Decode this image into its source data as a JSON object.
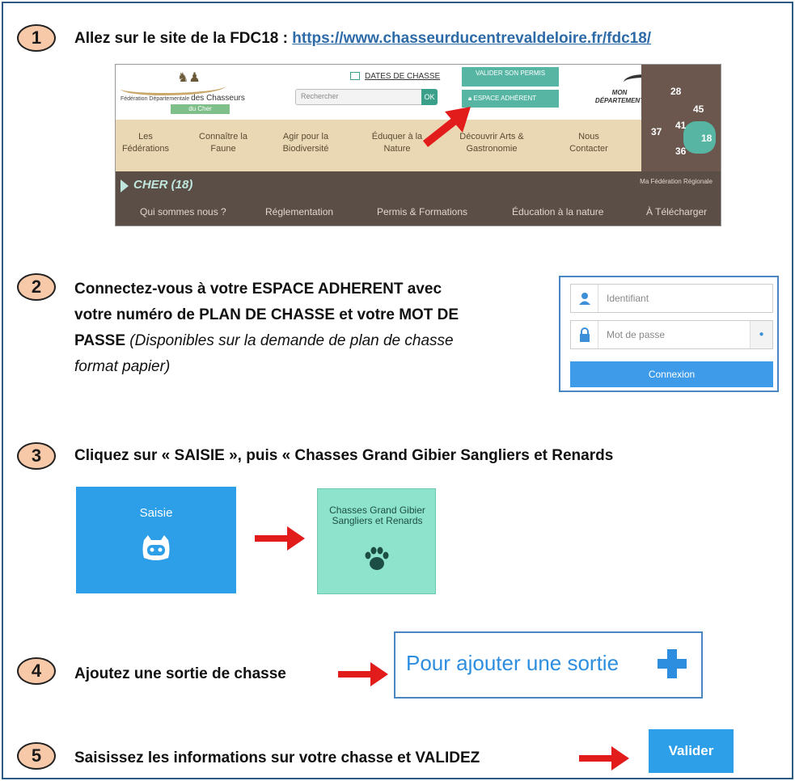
{
  "steps": {
    "s1": {
      "num": "1",
      "text": "Allez sur le site de la FDC18 : ",
      "url": "https://www.chasseurducentrevaldeloire.fr/fdc18/"
    },
    "s2": {
      "num": "2",
      "line1": "Connectez-vous à votre ESPACE ADHERENT avec",
      "line2": "votre numéro de PLAN DE CHASSE et votre MOT DE",
      "line3_bold": "PASSE",
      "line3_italic": " (Disponibles sur la demande de plan de chasse",
      "line4_italic": "format papier)"
    },
    "s3": {
      "num": "3",
      "text": "Cliquez sur « SAISIE », puis « Chasses Grand Gibier Sangliers et Renards"
    },
    "s4": {
      "num": "4",
      "text": "Ajoutez une sortie de chasse"
    },
    "s5": {
      "num": "5",
      "text": "Saisissez les informations sur votre chasse et VALIDEZ"
    }
  },
  "site": {
    "logo_prefix": "Fédération Départementale",
    "logo_name": "des Chasseurs",
    "logo_sub": "du Cher",
    "search_placeholder": "Rechercher",
    "search_ok": "OK",
    "dates_link": "DATES DE CHASSE",
    "valider_permis": "VALIDER SON PERMIS",
    "espace_adherent": "ESPACE ADHÉRENT",
    "mon_departement": "MON DÉPARTEMENT",
    "nav": [
      {
        "l1": "Les",
        "l2": "Fédérations"
      },
      {
        "l1": "Connaître la",
        "l2": "Faune"
      },
      {
        "l1": "Agir pour la",
        "l2": "Biodiversité"
      },
      {
        "l1": "Éduquer à la",
        "l2": "Nature"
      },
      {
        "l1": "Découvrir Arts &",
        "l2": "Gastronomie"
      },
      {
        "l1": "Nous",
        "l2": "Contacter"
      }
    ],
    "dept_title": "CHER (18)",
    "regional": "Ma Fédération Régionale",
    "subnav": [
      "Qui sommes nous ?",
      "Réglementation",
      "Permis & Formations",
      "Éducation à la nature",
      "À Télécharger"
    ],
    "map_depts": [
      "28",
      "45",
      "41",
      "37",
      "18",
      "36"
    ]
  },
  "login": {
    "identifiant_placeholder": "Identifiant",
    "password_placeholder": "Mot de passe",
    "connexion": "Connexion"
  },
  "tiles": {
    "saisie": "Saisie",
    "chasses": "Chasses Grand Gibier Sangliers et Renards"
  },
  "ajouter": "Pour ajouter une sortie",
  "valider": "Valider",
  "colors": {
    "accent_blue": "#2d9ee8",
    "teal": "#56b5a3",
    "arrow_red": "#e21b1b",
    "badge": "#f8c9a8"
  }
}
